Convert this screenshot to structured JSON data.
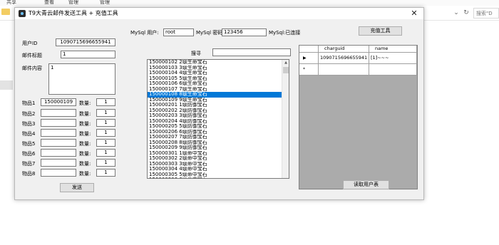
{
  "explorer": {
    "ribbon_tabs": [
      "共享",
      "查看",
      "管理",
      "管理"
    ],
    "nav_glyphs": [
      "⌄",
      "↻"
    ],
    "search_placeholder": "搜索\"D"
  },
  "dialog": {
    "title": "T9大青云邮件发送工具 + 充值工具",
    "close_glyph": "✕"
  },
  "mysql": {
    "user_label": "MySql 用户:",
    "user_value": "root",
    "password_label": "MySql 密码:",
    "password_value": "123456",
    "status_text": "MySql:已连接"
  },
  "recharge_button_label": "充值工具",
  "form": {
    "user_id_label": "用户ID",
    "user_id_value": "1090715696655941",
    "mail_title_label": "邮件标题",
    "mail_title_value": "1",
    "mail_content_label": "邮件内容",
    "mail_content_value": "1",
    "quantity_label": "数量:",
    "items": [
      {
        "label": "物品1",
        "value": "150000109",
        "quantity": "1"
      },
      {
        "label": "物品2",
        "value": "",
        "quantity": "1"
      },
      {
        "label": "物品3",
        "value": "",
        "quantity": "1"
      },
      {
        "label": "物品4",
        "value": "",
        "quantity": "1"
      },
      {
        "label": "物品5",
        "value": "",
        "quantity": "1"
      },
      {
        "label": "物品6",
        "value": "",
        "quantity": "1"
      },
      {
        "label": "物品7",
        "value": "",
        "quantity": "1"
      },
      {
        "label": "物品8",
        "value": "",
        "quantity": "1"
      }
    ],
    "send_button_label": "发送"
  },
  "search": {
    "label": "搜寻",
    "value": ""
  },
  "item_list": {
    "selected_index": 6,
    "entries": [
      "150000102 2级生命宝石",
      "150000103 3级生命宝石",
      "150000104 4级生命宝石",
      "150000105 5级生命宝石",
      "150000106 6级生命宝石",
      "150000107 7级生命宝石",
      "150000108 8级生命宝石",
      "150000109 9级生命宝石",
      "150000201 1级防御宝石",
      "150000202 2级防御宝石",
      "150000203 3级防御宝石",
      "150000204 4级防御宝石",
      "150000205 5级防御宝石",
      "150000206 6级防御宝石",
      "150000207 7级防御宝石",
      "150000208 8级防御宝石",
      "150000209 9级防御宝石",
      "150000301 1级命中宝石",
      "150000302 2级命中宝石",
      "150000303 3级命中宝石",
      "150000304 4级命中宝石",
      "150000305 5级命中宝石",
      "150000306 6级命中宝石",
      "150000307 7级命中宝石"
    ]
  },
  "grid": {
    "columns": [
      "charguid",
      "name"
    ],
    "rows": [
      {
        "marker": "▶",
        "charguid": "1090715696655941",
        "name": "[1]~~~"
      }
    ],
    "new_row_marker": "*"
  },
  "read_users_button_label": "读取用户表"
}
